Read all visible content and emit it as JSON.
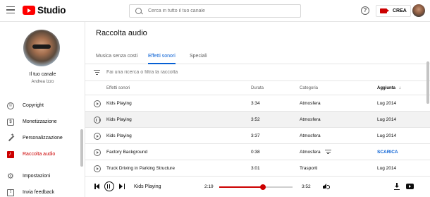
{
  "header": {
    "app_name": "Studio",
    "search_placeholder": "Cerca in tutto il tuo canale",
    "create_label": "CREA"
  },
  "sidebar": {
    "channel_title": "Il tuo canale",
    "channel_name": "Andrea Izzo",
    "items": [
      {
        "label": "Copyright",
        "icon": "copyright-icon",
        "active": false
      },
      {
        "label": "Monetizzazione",
        "icon": "dollar-icon",
        "active": false
      },
      {
        "label": "Personalizzazione",
        "icon": "magic-wand-icon",
        "active": false
      },
      {
        "label": "Raccolta audio",
        "icon": "audio-library-icon",
        "active": true
      }
    ],
    "bottom_items": [
      {
        "label": "Impostazioni",
        "icon": "gear-icon"
      },
      {
        "label": "Invia feedback",
        "icon": "feedback-icon"
      }
    ]
  },
  "main": {
    "title": "Raccolta audio",
    "tabs": [
      {
        "label": "Musica senza costi",
        "active": false
      },
      {
        "label": "Effetti sonori",
        "active": true
      },
      {
        "label": "Speciali",
        "active": false
      }
    ],
    "filter_placeholder": "Fai una ricerca o filtra la raccolta",
    "columns": {
      "name": "Effetti sonori",
      "duration": "Durata",
      "category": "Categoria",
      "added": "Aggiunta",
      "sort_indicator": "↓"
    },
    "rows": [
      {
        "name": "Kids Playing",
        "duration": "3:34",
        "category": "Atmosfera",
        "added": "Lug 2014",
        "playing": false
      },
      {
        "name": "Kids Playing",
        "duration": "3:52",
        "category": "Atmosfera",
        "added": "Lug 2014",
        "playing": true
      },
      {
        "name": "Kids Playing",
        "duration": "3:37",
        "category": "Atmosfera",
        "added": "Lug 2014",
        "playing": false
      },
      {
        "name": "Factory Background",
        "duration": "0:38",
        "category": "Atmosfera",
        "added": "",
        "action": "SCARICA",
        "playing": false
      },
      {
        "name": "Truck Driving in Parking Structure",
        "duration": "3:01",
        "category": "Trasporti",
        "added": "Lug 2014",
        "playing": false
      }
    ]
  },
  "player": {
    "title": "Kids Playing",
    "elapsed": "2:19",
    "total": "3:52",
    "progress": 0.6
  },
  "colors": {
    "accent": "#cc0000",
    "link": "#065fd4"
  }
}
